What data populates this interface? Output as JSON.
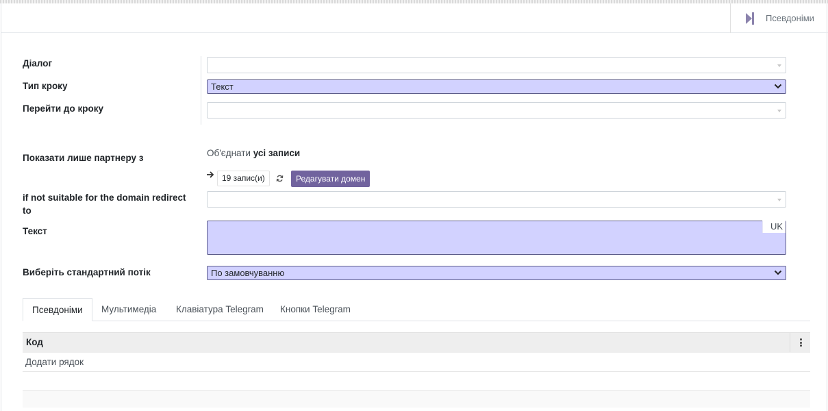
{
  "header": {
    "stat_button_label": "Псевдоніми"
  },
  "form": {
    "dialog": {
      "label": "Діалог",
      "value": ""
    },
    "step_type": {
      "label": "Тип кроку",
      "value": "Текст"
    },
    "next_step": {
      "label": "Перейти до кроку",
      "value": ""
    },
    "domain": {
      "label": "Показати лише партнеру з",
      "match_prefix": "Об'єднати",
      "match_scope": "усі записи",
      "records_count": "19 запис(и)",
      "edit_button": "Редагувати домен"
    },
    "redirect": {
      "label": "if not suitable for the domain redirect to",
      "value": ""
    },
    "text": {
      "label": "Текст",
      "value": "",
      "lang": "UK"
    },
    "flow": {
      "label": "Виберіть стандартний потік",
      "value": "По замовчуванню"
    }
  },
  "tabs": [
    {
      "label": "Псевдоніми",
      "active": true
    },
    {
      "label": "Мультимедіа",
      "active": false
    },
    {
      "label": "Клавіатура Telegram",
      "active": false
    },
    {
      "label": "Кнопки Telegram",
      "active": false
    }
  ],
  "table": {
    "columns": [
      "Код"
    ],
    "add_row_label": "Додати рядок"
  },
  "colors": {
    "accent": "#71639e",
    "required_field_bg": "#d2d2ff"
  },
  "icons": {
    "stat": "step-forward-icon",
    "arrow": "arrow-right-icon",
    "refresh": "refresh-icon",
    "options": "vertical-dots-icon"
  }
}
